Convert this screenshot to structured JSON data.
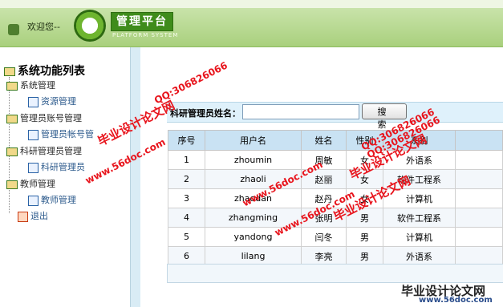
{
  "header": {
    "welcome": "欢迎您--",
    "platform_title": "管理平台",
    "platform_sub": "PLATFORM SYSTEM"
  },
  "sidebar": {
    "root": "系统功能列表",
    "items": [
      {
        "label": "系统管理"
      },
      {
        "label": "资源管理"
      },
      {
        "label": "管理员账号管理"
      },
      {
        "label": "管理员帐号管"
      },
      {
        "label": "科研管理员管理"
      },
      {
        "label": "科研管理员"
      },
      {
        "label": "教师管理"
      },
      {
        "label": "教师管理"
      },
      {
        "label": "退出"
      }
    ]
  },
  "search": {
    "label": "科研管理员姓名：",
    "value": "",
    "button": "搜 索"
  },
  "table": {
    "headers": [
      "序号",
      "用户名",
      "姓名",
      "性别",
      "系别"
    ],
    "rows": [
      [
        "1",
        "zhoumin",
        "周敏",
        "女",
        "外语系"
      ],
      [
        "2",
        "zhaoli",
        "赵丽",
        "女",
        "软件工程系"
      ],
      [
        "3",
        "zhaodan",
        "赵丹",
        "女",
        "计算机"
      ],
      [
        "4",
        "zhangming",
        "张明",
        "男",
        "软件工程系"
      ],
      [
        "5",
        "yandong",
        "闫冬",
        "男",
        "计算机"
      ],
      [
        "6",
        "lilang",
        "李亮",
        "男",
        "外语系"
      ]
    ]
  },
  "watermarks": {
    "site1": "毕业设计论文网",
    "qq1": "QQ:306826066",
    "url1": "www.56doc.com",
    "site2": "毕业设计论文网",
    "qq2": "QQ:306826066",
    "url2": "www.56doc.com",
    "site3": "毕业设计论文网",
    "qq3": "QQ:306826066",
    "url3": "www.56doc.com",
    "corner_site": "毕业设计论文网",
    "corner_url": "www.56doc.com"
  }
}
